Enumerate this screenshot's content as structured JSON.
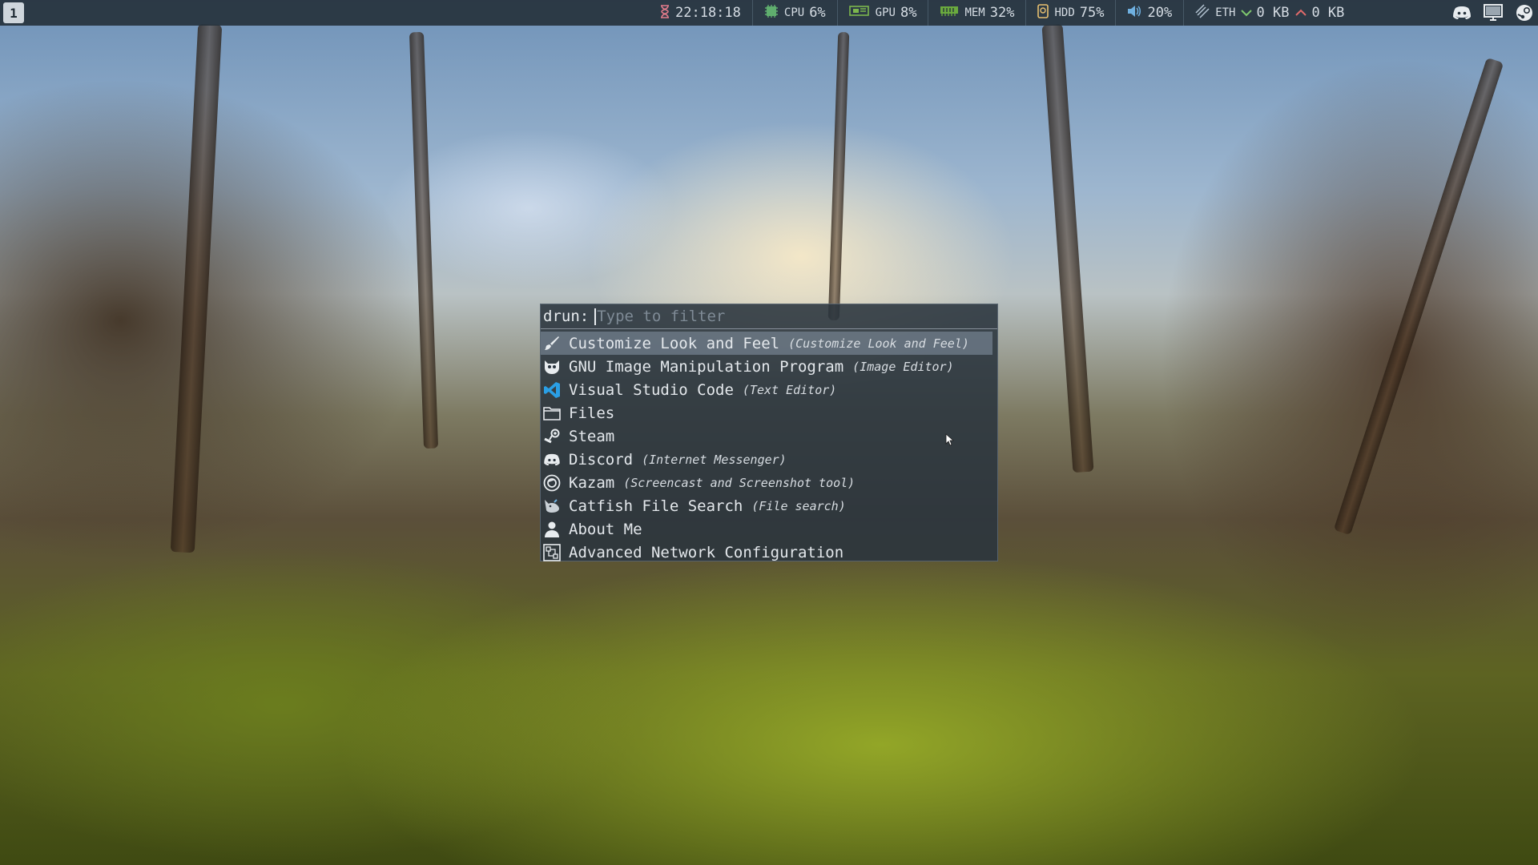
{
  "topbar": {
    "workspace": "1",
    "clock": {
      "icon": "hourglass-icon",
      "value": "22:18:18"
    },
    "cpu": {
      "icon": "cpu-icon",
      "label": "CPU",
      "value": "6%"
    },
    "gpu": {
      "icon": "gpu-icon",
      "label": "GPU",
      "value": "8%"
    },
    "mem": {
      "icon": "memory-icon",
      "label": "MEM",
      "value": "32%"
    },
    "hdd": {
      "icon": "hdd-icon",
      "label": "HDD",
      "value": "75%"
    },
    "volume": {
      "icon": "volume-icon",
      "value": "20%"
    },
    "net": {
      "icon": "ethernet-icon",
      "label": "ETH",
      "down": "0 KB",
      "up": "0 KB"
    },
    "tray": [
      "discord-icon",
      "monitor-icon",
      "steam-icon"
    ]
  },
  "launcher": {
    "mode": "drun:",
    "placeholder": "Type to filter",
    "entries": [
      {
        "name": "Customize Look and Feel",
        "desc": "(Customize Look and Feel)",
        "icon": "paintbrush-icon",
        "selected": true
      },
      {
        "name": "GNU Image Manipulation Program",
        "desc": "(Image Editor)",
        "icon": "gimp-icon"
      },
      {
        "name": "Visual Studio Code",
        "desc": "(Text Editor)",
        "icon": "vscode-icon"
      },
      {
        "name": "Files",
        "desc": "",
        "icon": "folder-icon"
      },
      {
        "name": "Steam",
        "desc": "",
        "icon": "steam-icon"
      },
      {
        "name": "Discord",
        "desc": "(Internet Messenger)",
        "icon": "discord-icon"
      },
      {
        "name": "Kazam",
        "desc": "(Screencast and Screenshot tool)",
        "icon": "kazam-icon"
      },
      {
        "name": "Catfish File Search",
        "desc": "(File search)",
        "icon": "catfish-icon"
      },
      {
        "name": "About Me",
        "desc": "",
        "icon": "user-icon"
      },
      {
        "name": "Advanced Network Configuration",
        "desc": "",
        "icon": "network-icon"
      }
    ]
  },
  "colors": {
    "bar_bg": "#26323c",
    "launcher_bg": "#2a343e",
    "selected_bg": "#87969f",
    "vscode_blue": "#2a9fe6"
  }
}
